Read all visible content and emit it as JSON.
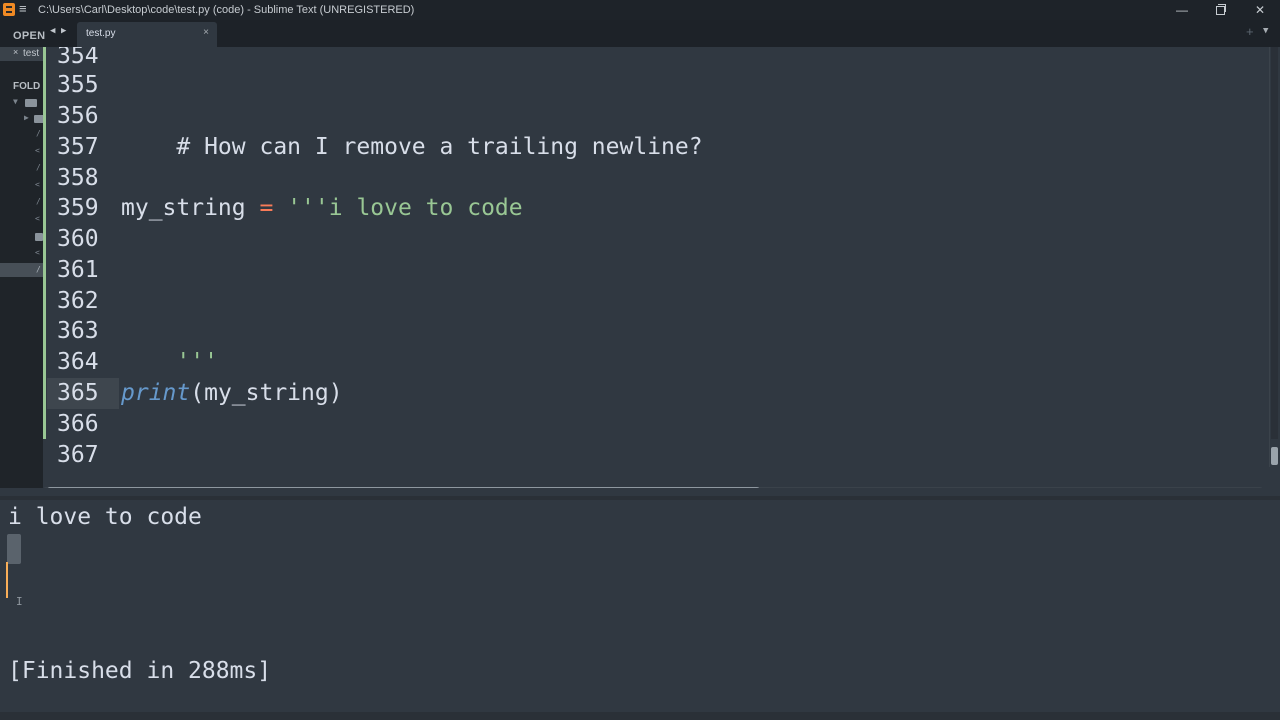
{
  "window": {
    "title": "C:\\Users\\Carl\\Desktop\\code\\test.py (code) - Sublime Text (UNREGISTERED)",
    "menu_icon": "≡",
    "minimize": "—",
    "close": "✕"
  },
  "tabbar": {
    "open_files_label": "OPEN",
    "nav_back": "◀",
    "nav_forward": "▶",
    "tab_label": "test.py",
    "tab_close": "×",
    "new_tab": "+",
    "tab_menu": "▼"
  },
  "sidebar": {
    "open_file_close": "×",
    "open_file_label": "test",
    "folders_label": "FOLD"
  },
  "editor": {
    "line_numbers": [
      "354",
      "355",
      "356",
      "357",
      "358",
      "359",
      "360",
      "361",
      "362",
      "363",
      "364",
      "365",
      "366",
      "367"
    ],
    "active_line": "365",
    "lines": {
      "l356": "# How can I remove a trailing newline?",
      "l359_var": "my_string",
      "l359_op": "=",
      "l359_str": "'''i love to code",
      "l363_str": "'''",
      "l365_fn": "print",
      "l365_args": "(my_string)"
    }
  },
  "output": {
    "line1": "i love to code",
    "finished": "[Finished in 288ms]"
  },
  "colors": {
    "background": "#303841",
    "comment": "#d8dee9",
    "operator": "#f97b58",
    "string": "#99c794",
    "function": "#6699cc",
    "cursor": "#f9ae58",
    "git_gutter": "#99c794"
  }
}
